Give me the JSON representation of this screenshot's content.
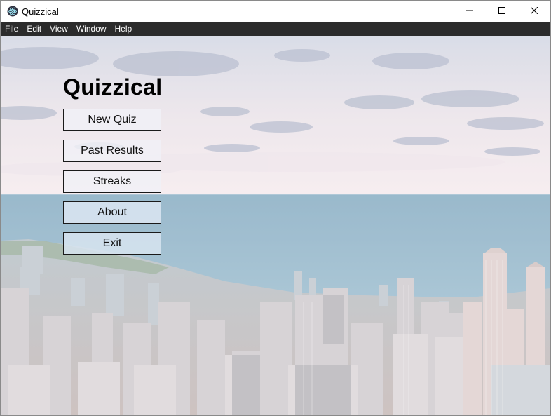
{
  "window": {
    "title": "Quizzical",
    "icon": "electron-atom-icon"
  },
  "window_controls": {
    "minimize_icon": "minimize-icon",
    "maximize_icon": "maximize-icon",
    "close_icon": "close-icon"
  },
  "menubar": {
    "items": [
      {
        "label": "File"
      },
      {
        "label": "Edit"
      },
      {
        "label": "View"
      },
      {
        "label": "Window"
      },
      {
        "label": "Help"
      }
    ]
  },
  "main": {
    "title": "Quizzical",
    "buttons": [
      {
        "label": "New Quiz"
      },
      {
        "label": "Past Results"
      },
      {
        "label": "Streaks"
      },
      {
        "label": "About"
      },
      {
        "label": "Exit"
      }
    ]
  },
  "colors": {
    "menubar_bg": "#2b2b2b",
    "button_border": "#1a1a1a",
    "title_text": "#000000"
  }
}
